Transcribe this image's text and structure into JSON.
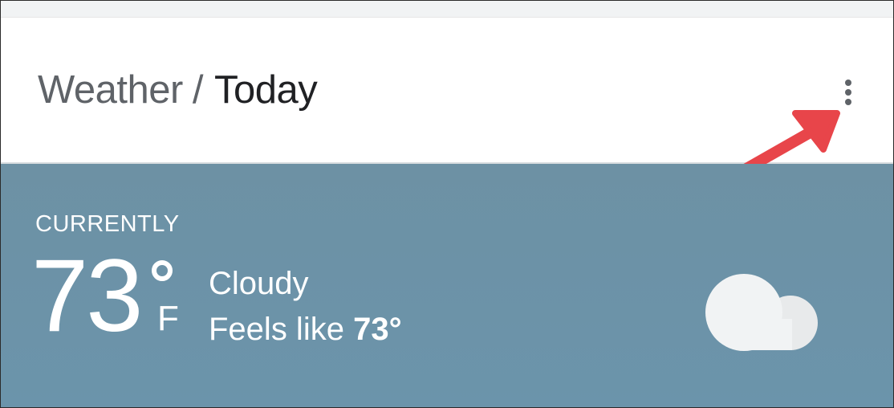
{
  "header": {
    "breadcrumb_parent": "Weather",
    "breadcrumb_separator": "/",
    "breadcrumb_current": "Today",
    "menu_icon": "more-vert-icon"
  },
  "annotation": {
    "arrow_color": "#e8454a"
  },
  "current": {
    "label": "CURRENTLY",
    "temperature": "73",
    "unit": "F",
    "condition": "Cloudy",
    "feels_like_label": "Feels like",
    "feels_like_value": "73°",
    "condition_icon": "cloud-icon"
  },
  "colors": {
    "card_background": "#6d91a4",
    "text_dark": "#202124",
    "text_gray": "#5f6368"
  }
}
